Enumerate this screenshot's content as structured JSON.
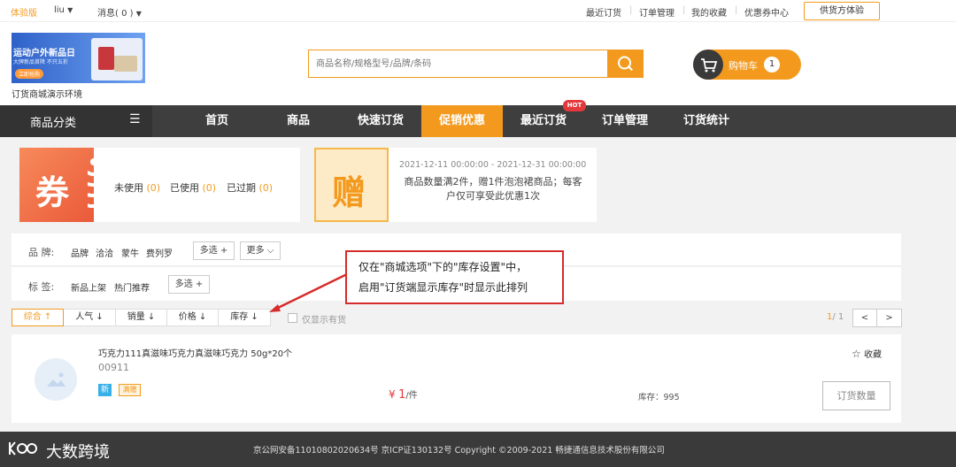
{
  "topbar": {
    "trial": "体验版",
    "user": "liu",
    "messages": "消息",
    "message_count": "( 0 )",
    "links": [
      "最近订货",
      "订单管理",
      "我的收藏",
      "优惠券中心"
    ],
    "supplier_button": "供货方体验"
  },
  "header": {
    "banner_title": "运动户外新品日",
    "banner_sub": "大牌新品首降 不只五折",
    "banner_btn": "立即抢购",
    "store_name": "订货商城演示环境",
    "search_placeholder": "商品名称/规格型号/品牌/条码",
    "cart_label": "购物车",
    "cart_count": "1"
  },
  "nav": {
    "category": "商品分类",
    "items": [
      "首页",
      "商品",
      "快速订货",
      "促销优惠",
      "最近订货",
      "订单管理",
      "订货统计"
    ],
    "active": "促销优惠",
    "hot_badge": "HOT"
  },
  "coupon": {
    "icon_char": "券",
    "unused": "未使用",
    "unused_count": "(0)",
    "used": "已使用",
    "used_count": "(0)",
    "expired": "已过期",
    "expired_count": "(0)"
  },
  "gift": {
    "icon_char": "赠",
    "dates": "2021-12-11 00:00:00 - 2021-12-31 00:00:00",
    "desc_line1": "商品数量满2件，赠1件泡泡裙商品；每客",
    "desc_line2": "户仅可享受此优惠1次"
  },
  "filters": {
    "brand_label": "品 牌:",
    "brands": [
      "品牌",
      "洽洽",
      "蒙牛",
      "费列罗"
    ],
    "multi": "多选",
    "more": "更多",
    "tag_label": "标 签:",
    "tags": [
      "新品上架",
      "热门推荐"
    ]
  },
  "annotation": {
    "line1": "仅在\"商城选项\"下的\"库存设置\"中，",
    "line2": "启用\"订货端显示库存\"时显示此排列",
    "color": "#d62b2b"
  },
  "sort": {
    "items": [
      "综合 ↑",
      "人气 ↓",
      "销量 ↓",
      "价格 ↓",
      "库存 ↓"
    ],
    "only_stock": "仅显示有货",
    "page_current": "1",
    "page_total": "/ 1",
    "prev": "<",
    "next": ">"
  },
  "product": {
    "name": "巧克力111真滋味巧克力真滋味巧克力 50g*20个",
    "code": "00911",
    "badge_new": "新",
    "badge_promo": "满赠",
    "currency": "¥",
    "price": "1",
    "unit": "/件",
    "stock_label": "库存：",
    "stock_value": "995",
    "favorite": "收藏",
    "order_button": "订货数量"
  },
  "footer": {
    "logo_text": "大数跨境",
    "copyright": "京公网安备11010802020634号 京ICP证130132号 Copyright ©2009-2021 畅捷通信息技术股份有限公司"
  },
  "colors": {
    "accent": "#f39a1e",
    "nav_bg": "#3e3e3e",
    "price_red": "#e4393c"
  }
}
